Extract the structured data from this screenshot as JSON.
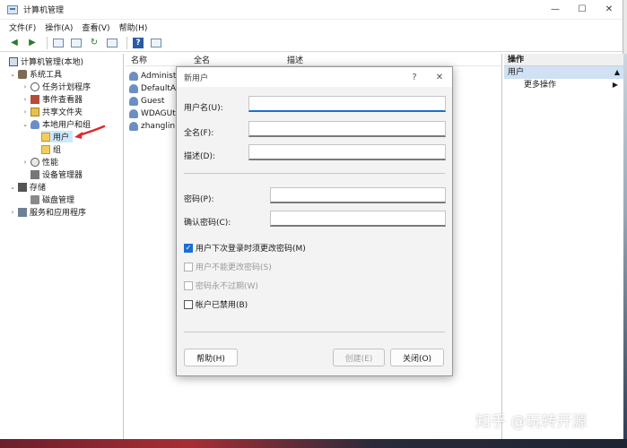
{
  "window": {
    "title": "计算机管理"
  },
  "menu": [
    "文件(F)",
    "操作(A)",
    "查看(V)",
    "帮助(H)"
  ],
  "tree": {
    "root": "计算机管理(本地)",
    "system_tools": "系统工具",
    "task_scheduler": "任务计划程序",
    "event_viewer": "事件查看器",
    "shared_folders": "共享文件夹",
    "local_users_groups": "本地用户和组",
    "users": "用户",
    "groups": "组",
    "performance": "性能",
    "device_manager": "设备管理器",
    "storage": "存储",
    "disk_management": "磁盘管理",
    "services_apps": "服务和应用程序"
  },
  "list": {
    "columns": [
      "名称",
      "全名",
      "描述"
    ],
    "rows": [
      "Administr",
      "DefaultAc",
      "Guest",
      "WDAGUti",
      "zhanglin"
    ]
  },
  "actions": {
    "header": "操作",
    "section": "用户",
    "more": "更多操作"
  },
  "dialog": {
    "title": "新用户",
    "help_glyph": "?",
    "username_label": "用户名(U):",
    "fullname_label": "全名(F):",
    "description_label": "描述(D):",
    "password_label": "密码(P):",
    "confirm_label": "确认密码(C):",
    "chk_must_change": "用户下次登录时须更改密码(M)",
    "chk_cannot_change": "用户不能更改密码(S)",
    "chk_never_expires": "密码永不过期(W)",
    "chk_disabled": "帐户已禁用(B)",
    "help_button": "帮助(H)",
    "create_button": "创建(E)",
    "close_button": "关闭(O)"
  },
  "watermark": "知乎 @玩转开源",
  "colors": {
    "accent": "#1a6fd1",
    "selection": "#cde8ff",
    "annotation_arrow": "#e0282a"
  }
}
